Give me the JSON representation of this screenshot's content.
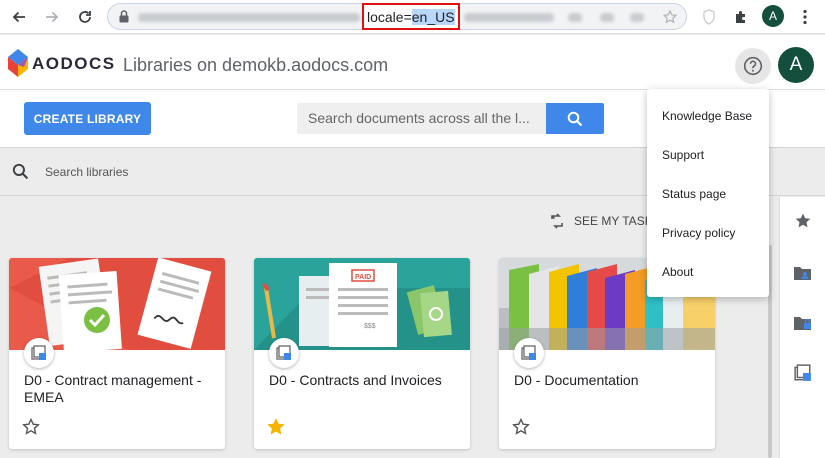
{
  "browser": {
    "url_highlight_prefix": "locale=",
    "url_highlight_value": "en_US",
    "profile_initial": "A"
  },
  "header": {
    "logo_text": "AODOCS",
    "title": "Libraries on demokb.aodocs.com",
    "avatar_initial": "A"
  },
  "toolbar": {
    "create_label": "CREATE LIBRARY",
    "search_placeholder": "Search documents across all the l..."
  },
  "library_search": {
    "placeholder": "Search libraries"
  },
  "tasks": {
    "label": "SEE MY TASK"
  },
  "cards": [
    {
      "title": "D0 - Contract management - EMEA",
      "starred": false
    },
    {
      "title": "D0 - Contracts and Invoices",
      "starred": true
    },
    {
      "title": "D0 - Documentation",
      "starred": false
    }
  ],
  "banner_text": {
    "paid": "PAID",
    "amount": "$$$"
  },
  "help_menu": {
    "items": [
      "Knowledge Base",
      "Support",
      "Status page",
      "Privacy policy",
      "About"
    ]
  },
  "colors": {
    "accent": "#3f87e8",
    "avatar": "#134f3c",
    "star_active": "#f4b400",
    "highlight_border": "#e01010"
  }
}
